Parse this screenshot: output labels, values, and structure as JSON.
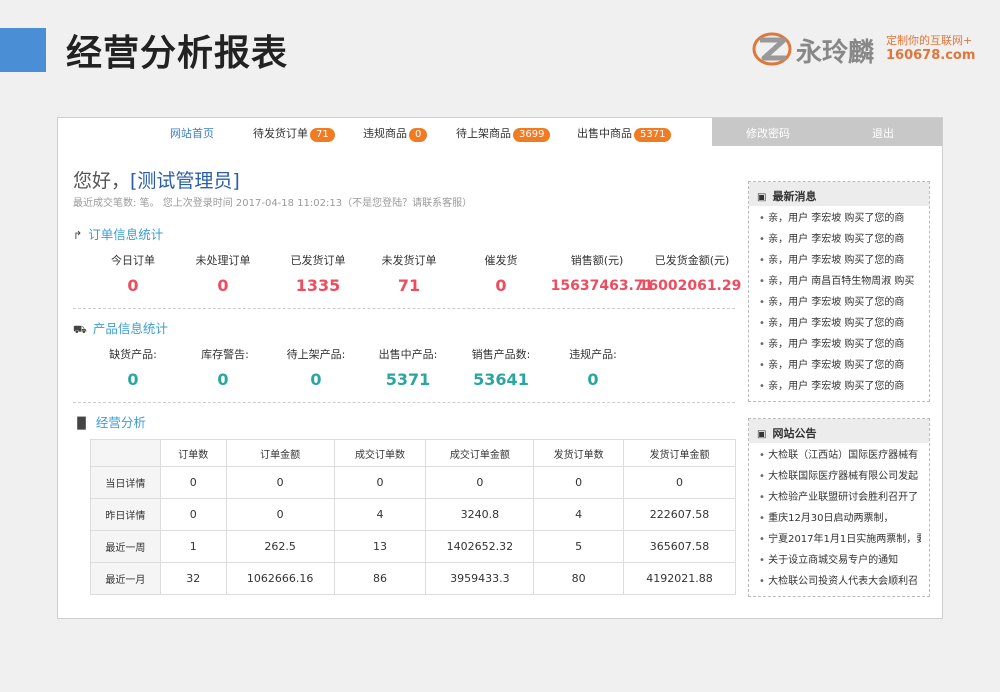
{
  "slide": {
    "title": "经营分析报表",
    "logo_name": "永玲麟",
    "logo_tag": "定制你的互联网+",
    "logo_url": "160678.com"
  },
  "nav": {
    "home": "网站首页",
    "items": [
      {
        "label": "待发货订单",
        "count": "71"
      },
      {
        "label": "违规商品",
        "count": "0"
      },
      {
        "label": "待上架商品",
        "count": "3699"
      },
      {
        "label": "出售中商品",
        "count": "5371"
      }
    ],
    "change_password": "修改密码",
    "logout": "退出"
  },
  "greeting": {
    "hello": "您好，",
    "user": "[测试管理员]",
    "sub": "最近成交笔数: 笔。 您上次登录时间 2017-04-18 11:02:13（不是您登陆？请联系客服）"
  },
  "orders": {
    "title": "订单信息统计",
    "stats": [
      {
        "label": "今日订单",
        "value": "0"
      },
      {
        "label": "未处理订单",
        "value": "0"
      },
      {
        "label": "已发货订单",
        "value": "1335"
      },
      {
        "label": "未发货订单",
        "value": "71"
      },
      {
        "label": "催发货",
        "value": "0"
      },
      {
        "label": "销售额(元)",
        "value": "15637463.71"
      },
      {
        "label": "已发货金额(元)",
        "value": "16002061.29"
      }
    ]
  },
  "products": {
    "title": "产品信息统计",
    "stats": [
      {
        "label": "缺货产品:",
        "value": "0"
      },
      {
        "label": "库存警告:",
        "value": "0"
      },
      {
        "label": "待上架产品:",
        "value": "0"
      },
      {
        "label": "出售中产品:",
        "value": "5371"
      },
      {
        "label": "销售产品数:",
        "value": "53641"
      },
      {
        "label": "违规产品:",
        "value": "0"
      }
    ]
  },
  "analysis": {
    "title": "经营分析",
    "columns": [
      "",
      "订单数",
      "订单金额",
      "成交订单数",
      "成交订单金额",
      "发货订单数",
      "发货订单金额"
    ],
    "rows": [
      [
        "当日详情",
        "0",
        "0",
        "0",
        "0",
        "0",
        "0"
      ],
      [
        "昨日详情",
        "0",
        "0",
        "4",
        "3240.8",
        "4",
        "222607.58"
      ],
      [
        "最近一周",
        "1",
        "262.5",
        "13",
        "1402652.32",
        "5",
        "365607.58"
      ],
      [
        "最近一月",
        "32",
        "1062666.16",
        "86",
        "3959433.3",
        "80",
        "4192021.88"
      ]
    ]
  },
  "news": {
    "title": "最新消息",
    "items": [
      "亲，用户 李宏坡 购买了您的商",
      "亲，用户 李宏坡 购买了您的商",
      "亲，用户 李宏坡 购买了您的商",
      "亲，用户 南昌百特生物周淑 购买",
      "亲，用户 李宏坡 购买了您的商",
      "亲，用户 李宏坡 购买了您的商",
      "亲，用户 李宏坡 购买了您的商",
      "亲，用户 李宏坡 购买了您的商",
      "亲，用户 李宏坡 购买了您的商"
    ]
  },
  "notice": {
    "title": "网站公告",
    "items": [
      "大检联（江西站）国际医疗器械有",
      "大检联国际医疗器械有限公司发起",
      "大检验产业联盟研讨会胜利召开了",
      "重庆12月30日启动两票制，",
      "宁夏2017年1月1日实施两票制，要",
      "关于设立商城交易专户的通知",
      "大检联公司投资人代表大会顺利召"
    ]
  },
  "colors": {
    "accent": "#4a8fd6",
    "badge": "#f07b22",
    "red": "#ee4d5f",
    "teal": "#2aa6a0"
  }
}
